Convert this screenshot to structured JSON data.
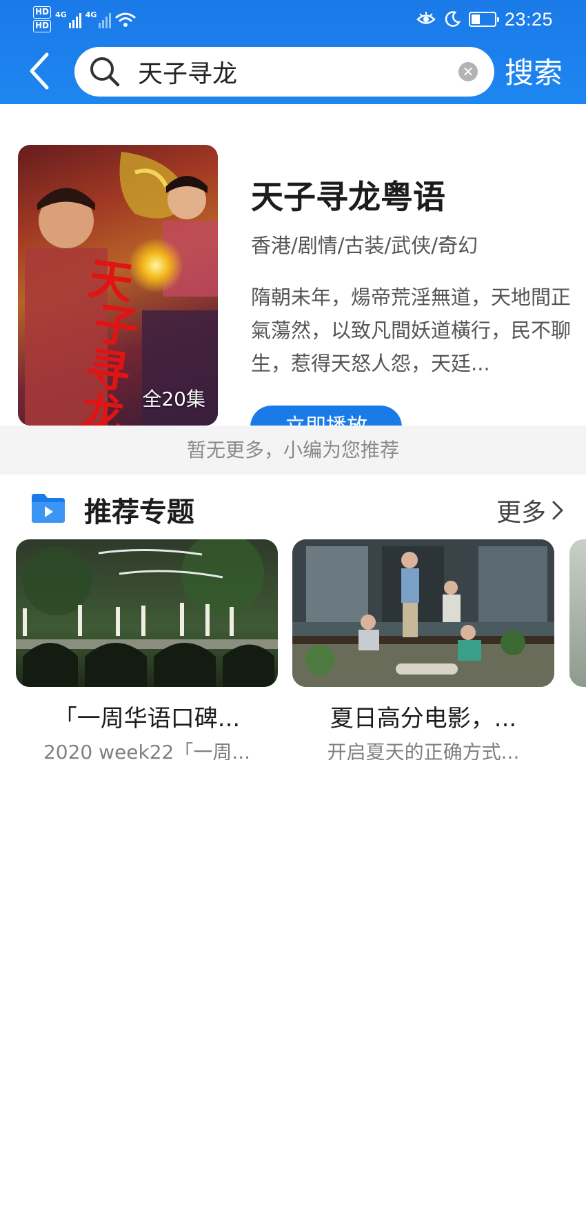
{
  "status_bar": {
    "hd1": "HD",
    "hd2": "HD",
    "sig1": "4G",
    "sig2": "4G",
    "time": "23:25",
    "icons": [
      "eye-comfort-icon",
      "moon-icon",
      "battery-icon",
      "wifi-icon"
    ]
  },
  "search": {
    "query": "天子寻龙",
    "button_label": "搜索"
  },
  "result": {
    "title": "天子寻龙粤语",
    "tags": "香港/剧情/古装/武侠/奇幻",
    "description": "隋朝未年，煬帝荒淫無道，天地間正氣蕩然，以致凡間妖道橫行，民不聊生，惹得天怒人怨，天廷...",
    "episodes": "全20集",
    "play_label": "立即播放"
  },
  "no_more_text": "暂无更多，小编为您推荐",
  "recommend": {
    "title": "推荐专题",
    "more_label": "更多",
    "cards": [
      {
        "title": "「一周华语口碑...",
        "subtitle": "2020 week22「一周..."
      },
      {
        "title": "夏日高分电影，...",
        "subtitle": "开启夏天的正确方式..."
      }
    ]
  },
  "colors": {
    "brand_blue": "#1a7ae8",
    "background": "#ffffff",
    "divider_bg": "#f4f4f4"
  }
}
